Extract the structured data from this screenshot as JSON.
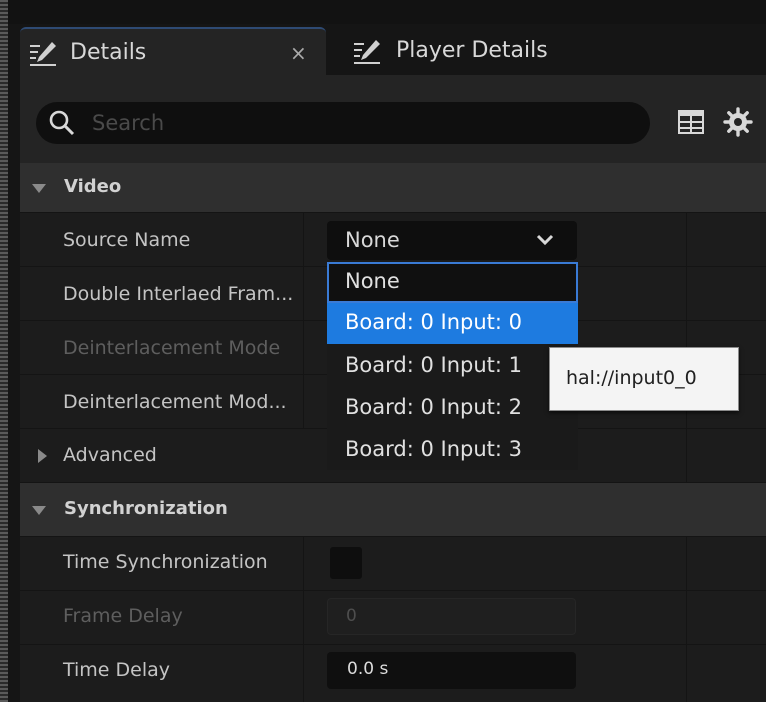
{
  "tabs": [
    {
      "label": "Details",
      "close": "×"
    },
    {
      "label": "Player Details"
    }
  ],
  "search": {
    "placeholder": "Search",
    "value": ""
  },
  "sections": {
    "video": {
      "title": "Video",
      "rows": [
        {
          "label": "Source Name"
        },
        {
          "label": "Double Interlaed Fram..."
        },
        {
          "label": "Deinterlacement Mode"
        },
        {
          "label": "Deinterlacement Mod..."
        }
      ]
    },
    "advanced": {
      "title": "Advanced"
    },
    "synchronization": {
      "title": "Synchronization",
      "rows": [
        {
          "label": "Time Synchronization"
        },
        {
          "label": "Frame Delay",
          "value": "0"
        },
        {
          "label": "Time Delay",
          "value": "0.0 s"
        }
      ]
    }
  },
  "source_combo": {
    "value": "None",
    "options": [
      "None",
      "Board: 0 Input: 0",
      "Board: 0 Input: 1",
      "Board: 0 Input: 2",
      "Board: 0 Input: 3"
    ],
    "highlighted": "Board: 0 Input: 0"
  },
  "tooltip": {
    "text": "hal://input0_0"
  },
  "time_synchronization_checked": false,
  "colors": {
    "panel": "#242424",
    "row": "#1c1c1c",
    "section": "#2f2f2f",
    "accent": "#1e7be0",
    "tab_accent": "#2e4a73"
  }
}
